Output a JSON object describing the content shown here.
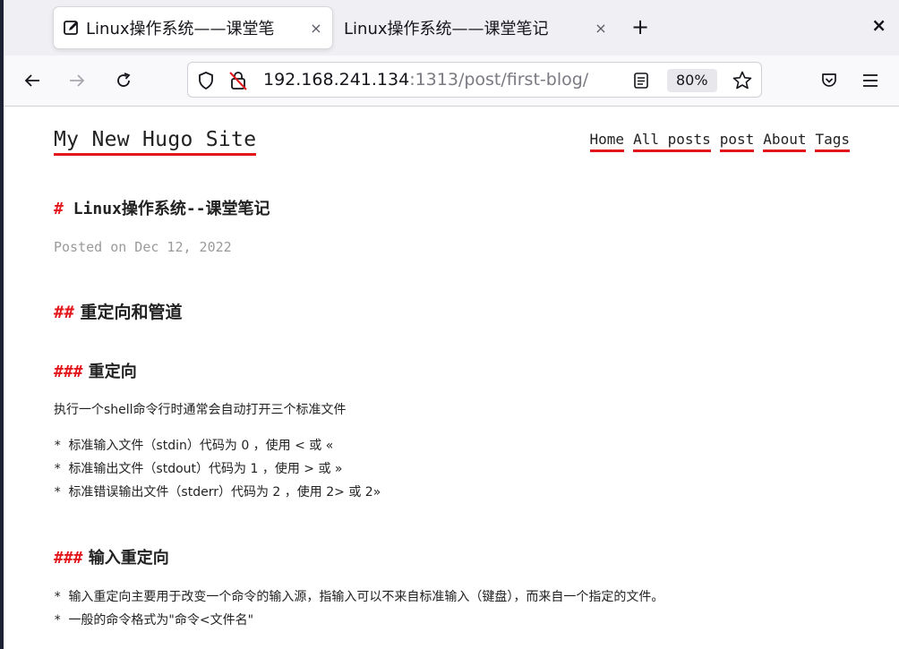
{
  "browser": {
    "tabs": [
      {
        "title": "Linux操作系统——课堂笔",
        "active": true
      },
      {
        "title": "Linux操作系统——课堂笔记",
        "active": false
      }
    ],
    "tab_close_glyph": "×",
    "new_tab_glyph": "+",
    "window_close_glyph": "×",
    "url_host": "192.168.241.134",
    "url_rest": ":1313/post/first-blog/",
    "zoom": "80%"
  },
  "site": {
    "title": "My New Hugo Site",
    "nav": [
      "Home",
      "All posts",
      "post",
      "About",
      "Tags"
    ]
  },
  "post": {
    "h1_hash": "#",
    "h1_text": "Linux操作系统--课堂笔记",
    "posted": "Posted on Dec 12, 2022",
    "h2_hash": "##",
    "h2_text": "重定向和管道",
    "h3a_hash": "###",
    "h3a_text": "重定向",
    "para1": "执行一个shell命令行时通常会自动打开三个标准文件",
    "bullet": "*",
    "list1": [
      "标准输入文件（stdin）代码为 0 ，使用 < 或 «",
      "标准输出文件（stdout）代码为 1 ，使用 > 或 »",
      "标准错误输出文件（stderr）代码为 2 ，使用 2> 或 2»"
    ],
    "h3b_hash": "###",
    "h3b_text": "输入重定向",
    "list2": [
      "输入重定向主要用于改变一个命令的输入源，指输入可以不来自标准输入（键盘），而来自一个指定的文件。",
      "一般的命令格式为\"命令<文件名\""
    ]
  },
  "colors": {
    "accent": "#e3161b",
    "muted": "#9a9a9a"
  }
}
